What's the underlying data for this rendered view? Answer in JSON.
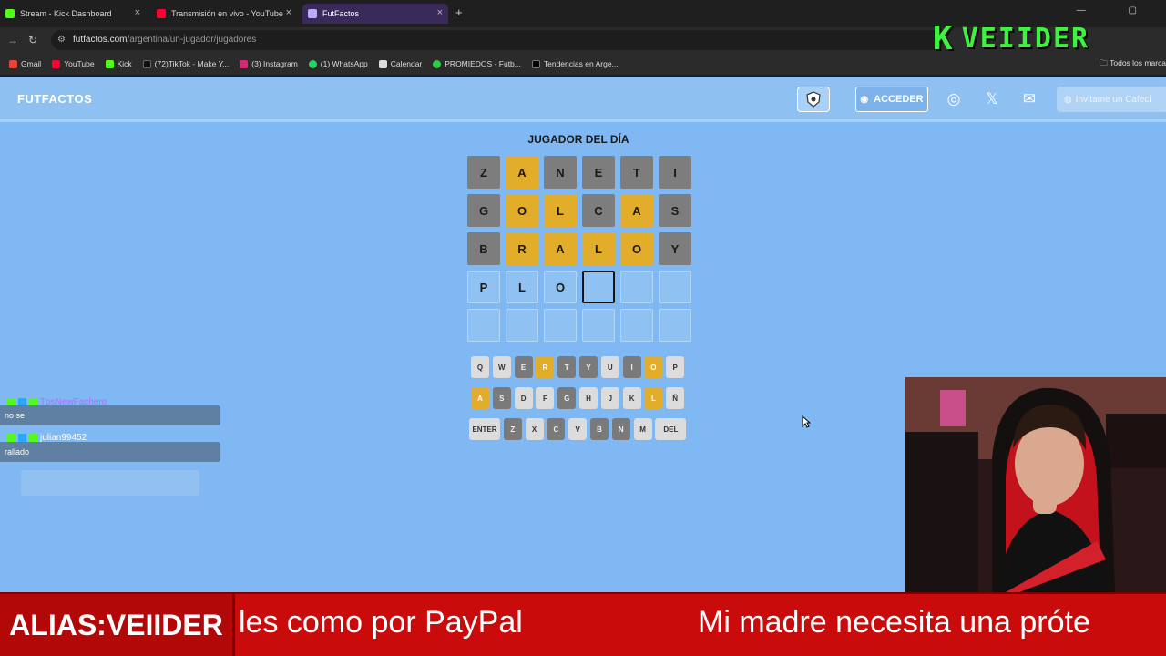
{
  "browser": {
    "tabs": [
      {
        "title": "Stream - Kick Dashboard",
        "color": "#53fc18"
      },
      {
        "title": "Transmisión en vivo - YouTube",
        "color": "#ff0033"
      },
      {
        "title": "FutFactos",
        "color": "#3a2a5a"
      }
    ],
    "url_domain": "futfactos.com",
    "url_path": "/argentina/un-jugador/jugadores",
    "bookmarks": [
      "Gmail",
      "YouTube",
      "Kick",
      "(72)TikTok - Make Y...",
      "(3) Instagram",
      "(1) WhatsApp",
      "Calendar",
      "PROMIEDOS - Futb...",
      "Tendencias en Arge..."
    ],
    "all_bookmarks": "Todos los marca"
  },
  "overlay": {
    "logo_letter": "K",
    "logo_name": "VEIIDER"
  },
  "site": {
    "title": "FUTFACTOS",
    "acceder": "ACCEDER",
    "cafecito": "Invitame un Cafeci"
  },
  "game": {
    "title": "JUGADOR DEL DÍA",
    "grid": [
      [
        [
          "Z",
          "gray"
        ],
        [
          "A",
          "yellow"
        ],
        [
          "N",
          "gray"
        ],
        [
          "E",
          "gray"
        ],
        [
          "T",
          "gray"
        ],
        [
          "I",
          "gray"
        ]
      ],
      [
        [
          "G",
          "gray"
        ],
        [
          "O",
          "yellow"
        ],
        [
          "L",
          "yellow"
        ],
        [
          "C",
          "gray"
        ],
        [
          "A",
          "yellow"
        ],
        [
          "S",
          "gray"
        ]
      ],
      [
        [
          "B",
          "gray"
        ],
        [
          "R",
          "yellow"
        ],
        [
          "A",
          "yellow"
        ],
        [
          "L",
          "yellow"
        ],
        [
          "O",
          "yellow"
        ],
        [
          "Y",
          "gray"
        ]
      ],
      [
        [
          "P",
          "empty"
        ],
        [
          "L",
          "empty"
        ],
        [
          "O",
          "empty"
        ],
        [
          "",
          "current"
        ],
        [
          "",
          "empty"
        ],
        [
          "",
          "empty"
        ]
      ],
      [
        [
          "",
          "empty"
        ],
        [
          "",
          "empty"
        ],
        [
          "",
          "empty"
        ],
        [
          "",
          "empty"
        ],
        [
          "",
          "empty"
        ],
        [
          "",
          "empty"
        ]
      ]
    ],
    "keyboard": [
      [
        [
          "Q",
          "light"
        ],
        [
          "W",
          "light"
        ],
        [
          "E",
          "gray"
        ],
        [
          "R",
          "yellow"
        ],
        [
          "T",
          "gray"
        ],
        [
          "Y",
          "gray"
        ],
        [
          "U",
          "light"
        ],
        [
          "I",
          "gray"
        ],
        [
          "O",
          "yellow"
        ],
        [
          "P",
          "light"
        ]
      ],
      [
        [
          "A",
          "yellow"
        ],
        [
          "S",
          "gray"
        ],
        [
          "D",
          "light"
        ],
        [
          "F",
          "light"
        ],
        [
          "G",
          "gray"
        ],
        [
          "H",
          "light"
        ],
        [
          "J",
          "light"
        ],
        [
          "K",
          "light"
        ],
        [
          "L",
          "yellow"
        ],
        [
          "Ñ",
          "light"
        ]
      ],
      [
        [
          "ENTER",
          "light"
        ],
        [
          "Z",
          "gray"
        ],
        [
          "X",
          "light"
        ],
        [
          "C",
          "gray"
        ],
        [
          "V",
          "light"
        ],
        [
          "B",
          "gray"
        ],
        [
          "N",
          "gray"
        ],
        [
          "M",
          "light"
        ],
        [
          "DEL",
          "light"
        ]
      ]
    ]
  },
  "chat": [
    {
      "user": "TpsNewFachero",
      "user_color": "#b06cff",
      "message": "no se"
    },
    {
      "user": "julian99452",
      "user_color": "#ffffff",
      "message": "rallado"
    }
  ],
  "ticker": {
    "alias": "ALIAS:VEIIDER",
    "text1": "les como por PayPal",
    "text2": "Mi madre necesita una próte"
  }
}
